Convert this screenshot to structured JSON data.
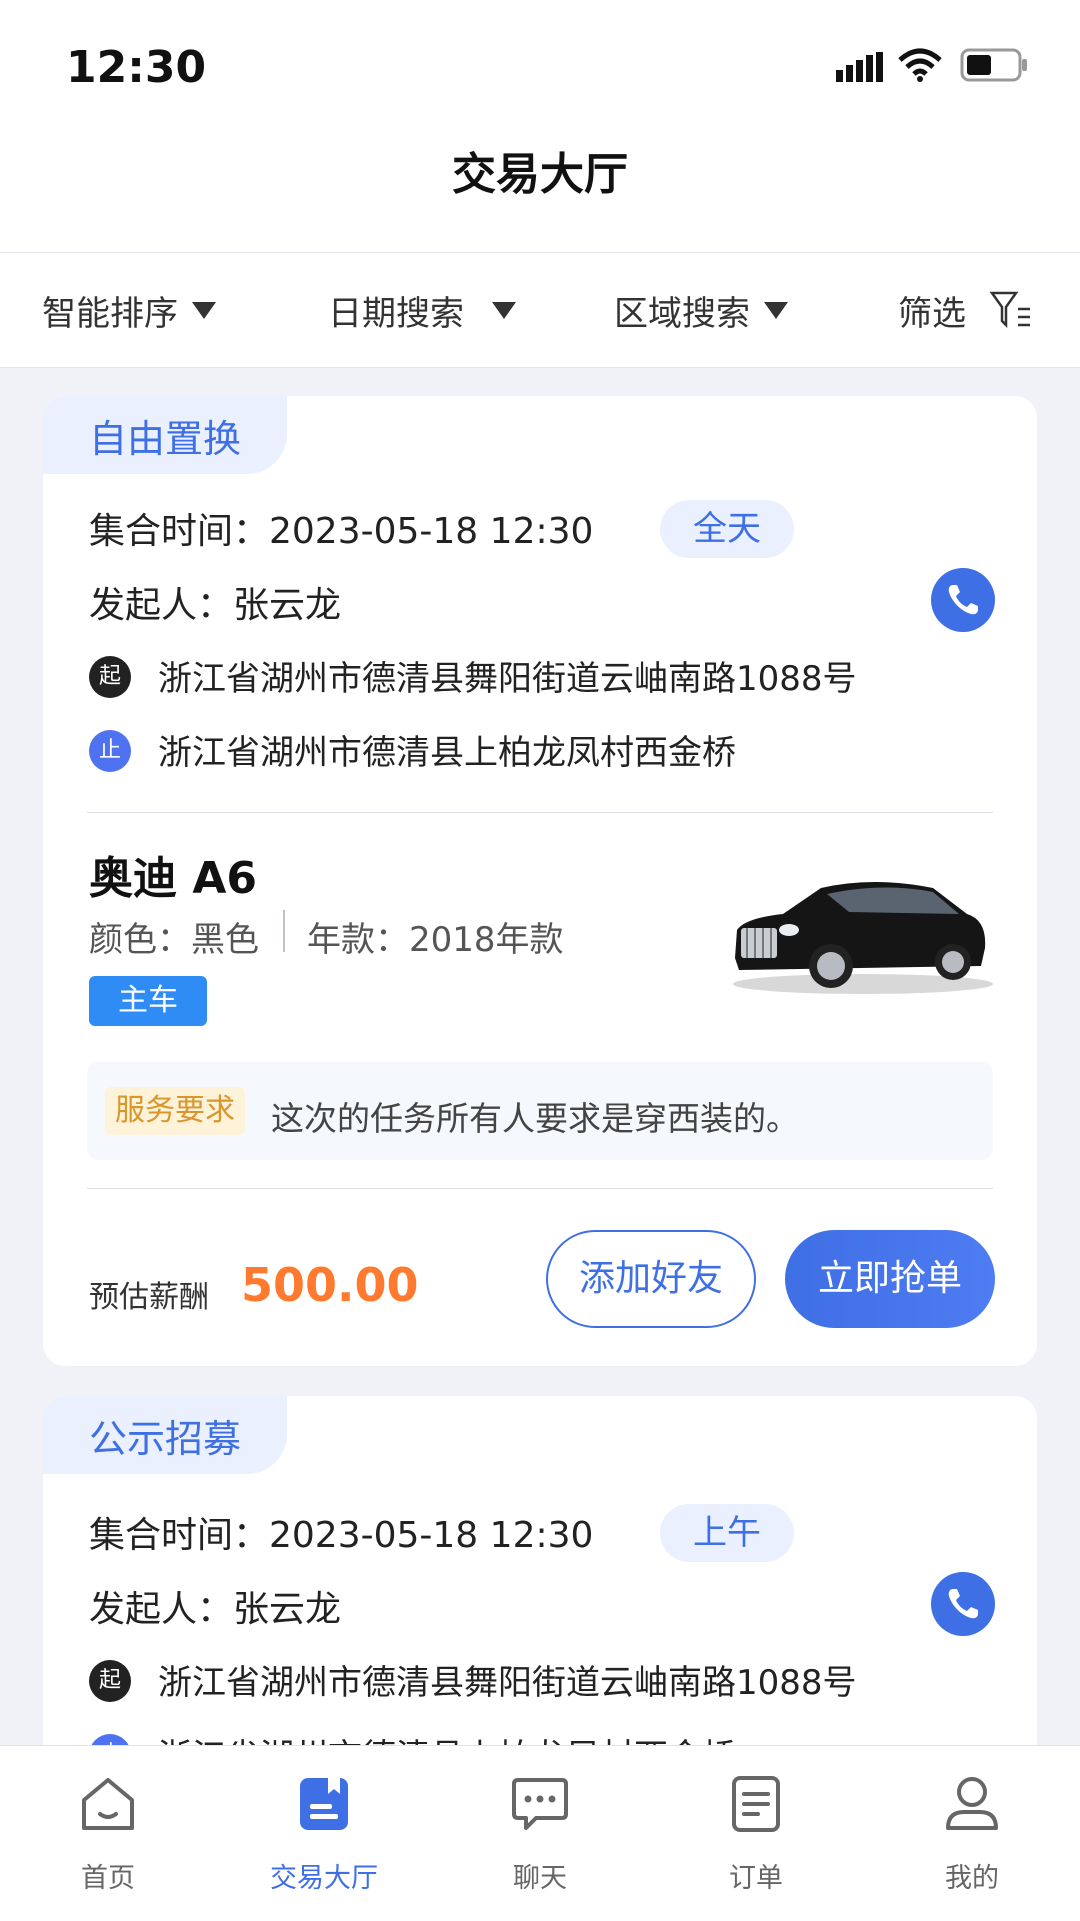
{
  "status_bar": {
    "time": "12:30"
  },
  "header": {
    "title": "交易大厅"
  },
  "filters": [
    {
      "label": "智能排序"
    },
    {
      "label": "日期搜索"
    },
    {
      "label": "区域搜索"
    },
    {
      "label": "筛选"
    }
  ],
  "cards": [
    {
      "type_tag": "自由置换",
      "time_label": "集合时间：2023-05-18 12:30",
      "time_pill": "全天",
      "initiator": "发起人：张云龙",
      "start_marker": "起",
      "start_address": "浙江省湖州市德清县舞阳街道云岫南路1088号",
      "end_marker": "止",
      "end_address": "浙江省湖州市德清县上柏龙凤村西金桥",
      "car_name": "奥迪 A6",
      "color_spec": "颜色：黑色",
      "year_spec": "年款：2018年款",
      "car_badge": "主车",
      "service_label": "服务要求",
      "service_text": "这次的任务所有人要求是穿西装的。",
      "reward_label": "预估薪酬",
      "reward_value": "500.00",
      "add_friend_label": "添加好友",
      "grab_label": "立即抢单"
    },
    {
      "type_tag": "公示招募",
      "time_label": "集合时间：2023-05-18 12:30",
      "time_pill": "上午",
      "initiator": "发起人：张云龙",
      "start_marker": "起",
      "start_address": "浙江省湖州市德清县舞阳街道云岫南路1088号",
      "end_marker": "止",
      "end_address": "浙江省湖州市德清县上柏龙凤村西金桥"
    }
  ],
  "tabbar": [
    {
      "label": "首页",
      "icon": "home-icon"
    },
    {
      "label": "交易大厅",
      "icon": "trade-hall-icon",
      "active": true
    },
    {
      "label": "聊天",
      "icon": "chat-icon"
    },
    {
      "label": "订单",
      "icon": "order-icon"
    },
    {
      "label": "我的",
      "icon": "profile-icon"
    }
  ],
  "colors": {
    "accent": "#3F6FE4",
    "reward": "#FF7A2F",
    "background": "#F0F2F7"
  }
}
